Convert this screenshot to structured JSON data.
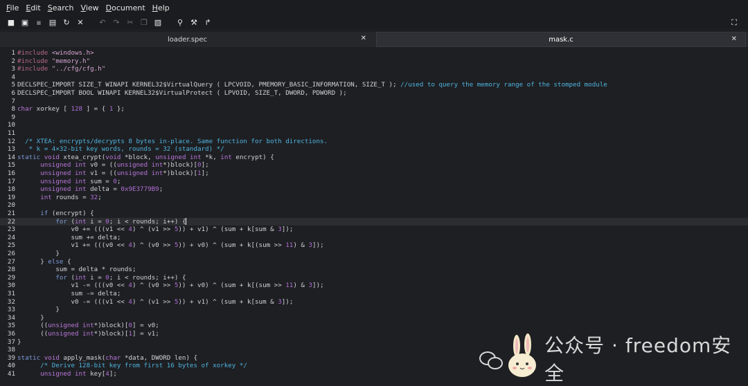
{
  "menu": [
    "File",
    "Edit",
    "Search",
    "View",
    "Document",
    "Help"
  ],
  "menu_underline_first": true,
  "toolbar_icons": [
    {
      "name": "new-file-icon",
      "glyph": "■",
      "dim": false
    },
    {
      "name": "new-window-icon",
      "glyph": "▣",
      "dim": false
    },
    {
      "name": "save-icon",
      "glyph": "▪",
      "dim": true
    },
    {
      "name": "save-as-icon",
      "glyph": "▤",
      "dim": false
    },
    {
      "name": "reload-icon",
      "glyph": "↻",
      "dim": false
    },
    {
      "name": "close-icon",
      "glyph": "✕",
      "dim": false
    },
    {
      "name": "gap",
      "glyph": "",
      "dim": false
    },
    {
      "name": "undo-icon",
      "glyph": "↶",
      "dim": true
    },
    {
      "name": "redo-icon",
      "glyph": "↷",
      "dim": true
    },
    {
      "name": "cut-icon",
      "glyph": "✂",
      "dim": true
    },
    {
      "name": "copy-icon",
      "glyph": "❐",
      "dim": true
    },
    {
      "name": "paste-icon",
      "glyph": "▧",
      "dim": false
    },
    {
      "name": "gap",
      "glyph": "",
      "dim": false
    },
    {
      "name": "search-icon",
      "glyph": "⚲",
      "dim": false
    },
    {
      "name": "replace-icon",
      "glyph": "⚒",
      "dim": false
    },
    {
      "name": "goto-icon",
      "glyph": "↱",
      "dim": false
    }
  ],
  "fullscreen_glyph": "⛶",
  "tabs": [
    {
      "label": "loader.spec",
      "close": "✕"
    },
    {
      "label": "mask.c",
      "close": "✕"
    }
  ],
  "current_line": 22,
  "lines": [
    {
      "n": "1",
      "t": [
        [
          "pp",
          "#include "
        ],
        [
          "str",
          "<windows.h>"
        ]
      ]
    },
    {
      "n": "2",
      "t": [
        [
          "pp",
          "#include "
        ],
        [
          "str",
          "\"memory.h\""
        ]
      ]
    },
    {
      "n": "3",
      "t": [
        [
          "pp",
          "#include "
        ],
        [
          "str",
          "\"../cfg/cfg.h\""
        ]
      ]
    },
    {
      "n": "4",
      "t": []
    },
    {
      "n": "5",
      "t": [
        [
          "",
          "DECLSPEC_IMPORT SIZE_T WINAPI KERNEL32$VirtualQuery ( LPCVOID, PMEMORY_BASIC_INFORMATION, SIZE_T ); "
        ],
        [
          "cm",
          "//used to query the memory range of the stomped module"
        ]
      ]
    },
    {
      "n": "6",
      "t": [
        [
          "",
          "DECLSPEC_IMPORT BOOL WINAPI KERNEL32$VirtualProtect ( LPVOID, SIZE_T, DWORD, PDWORD );"
        ]
      ]
    },
    {
      "n": "7",
      "t": []
    },
    {
      "n": "8",
      "t": [
        [
          "ty",
          "char"
        ],
        [
          "",
          " xorkey [ "
        ],
        [
          "num",
          "128"
        ],
        [
          "",
          " ] = { "
        ],
        [
          "num",
          "1"
        ],
        [
          "",
          " };"
        ]
      ]
    },
    {
      "n": "9",
      "t": []
    },
    {
      "n": "10",
      "t": []
    },
    {
      "n": "11",
      "t": []
    },
    {
      "n": "12",
      "t": [
        [
          "cm",
          "  /* XTEA: encrypts/decrypts 8 bytes in-place. Same function for both directions."
        ]
      ]
    },
    {
      "n": "13",
      "t": [
        [
          "cm",
          "   * k = 4×32-bit key words, rounds = 32 (standard) */"
        ]
      ]
    },
    {
      "n": "14",
      "t": [
        [
          "kw",
          "static"
        ],
        [
          "",
          " "
        ],
        [
          "ty",
          "void"
        ],
        [
          "",
          " xtea_crypt("
        ],
        [
          "ty",
          "void"
        ],
        [
          "",
          " *block, "
        ],
        [
          "ty",
          "unsigned int"
        ],
        [
          "",
          " *k, "
        ],
        [
          "ty",
          "int"
        ],
        [
          "",
          " encrypt) {"
        ]
      ]
    },
    {
      "n": "15",
      "t": [
        [
          "",
          "      "
        ],
        [
          "ty",
          "unsigned int"
        ],
        [
          "",
          " v0 = (("
        ],
        [
          "ty",
          "unsigned int"
        ],
        [
          "",
          "*)block)["
        ],
        [
          "num",
          "0"
        ],
        [
          "",
          "];"
        ]
      ]
    },
    {
      "n": "16",
      "t": [
        [
          "",
          "      "
        ],
        [
          "ty",
          "unsigned int"
        ],
        [
          "",
          " v1 = (("
        ],
        [
          "ty",
          "unsigned int"
        ],
        [
          "",
          "*)block)["
        ],
        [
          "num",
          "1"
        ],
        [
          "",
          "];"
        ]
      ]
    },
    {
      "n": "17",
      "t": [
        [
          "",
          "      "
        ],
        [
          "ty",
          "unsigned int"
        ],
        [
          "",
          " sum = "
        ],
        [
          "num",
          "0"
        ],
        [
          "",
          ";"
        ]
      ]
    },
    {
      "n": "18",
      "t": [
        [
          "",
          "      "
        ],
        [
          "ty",
          "unsigned int"
        ],
        [
          "",
          " delta = "
        ],
        [
          "num",
          "0x9E3779B9"
        ],
        [
          "",
          ";"
        ]
      ]
    },
    {
      "n": "19",
      "t": [
        [
          "",
          "      "
        ],
        [
          "ty",
          "int"
        ],
        [
          "",
          " rounds = "
        ],
        [
          "num",
          "32"
        ],
        [
          "",
          ";"
        ]
      ]
    },
    {
      "n": "20",
      "t": []
    },
    {
      "n": "21",
      "t": [
        [
          "",
          "      "
        ],
        [
          "kw",
          "if"
        ],
        [
          "",
          " (encrypt) {"
        ]
      ]
    },
    {
      "n": "22",
      "t": [
        [
          "",
          "          "
        ],
        [
          "kw",
          "for"
        ],
        [
          "",
          " ("
        ],
        [
          "ty",
          "int"
        ],
        [
          "",
          " i = "
        ],
        [
          "num",
          "0"
        ],
        [
          "",
          "; i < rounds; i++) {"
        ]
      ]
    },
    {
      "n": "23",
      "t": [
        [
          "",
          "              v0 += (((v1 << "
        ],
        [
          "num",
          "4"
        ],
        [
          "",
          ") ^ (v1 >> "
        ],
        [
          "num",
          "5"
        ],
        [
          "",
          ")) + v1) ^ (sum + k[sum & "
        ],
        [
          "num",
          "3"
        ],
        [
          "",
          "]);"
        ]
      ]
    },
    {
      "n": "24",
      "t": [
        [
          "",
          "              sum += delta;"
        ]
      ]
    },
    {
      "n": "25",
      "t": [
        [
          "",
          "              v1 += (((v0 << "
        ],
        [
          "num",
          "4"
        ],
        [
          "",
          ") ^ (v0 >> "
        ],
        [
          "num",
          "5"
        ],
        [
          "",
          ")) + v0) ^ (sum + k[(sum >> "
        ],
        [
          "num",
          "11"
        ],
        [
          "",
          ") & "
        ],
        [
          "num",
          "3"
        ],
        [
          "",
          "]);"
        ]
      ]
    },
    {
      "n": "26",
      "t": [
        [
          "",
          "          }"
        ]
      ]
    },
    {
      "n": "27",
      "t": [
        [
          "",
          "      } "
        ],
        [
          "kw",
          "else"
        ],
        [
          "",
          " {"
        ]
      ]
    },
    {
      "n": "28",
      "t": [
        [
          "",
          "          sum = delta * rounds;"
        ]
      ]
    },
    {
      "n": "29",
      "t": [
        [
          "",
          "          "
        ],
        [
          "kw",
          "for"
        ],
        [
          "",
          " ("
        ],
        [
          "ty",
          "int"
        ],
        [
          "",
          " i = "
        ],
        [
          "num",
          "0"
        ],
        [
          "",
          "; i < rounds; i++) {"
        ]
      ]
    },
    {
      "n": "30",
      "t": [
        [
          "",
          "              v1 -= (((v0 << "
        ],
        [
          "num",
          "4"
        ],
        [
          "",
          ") ^ (v0 >> "
        ],
        [
          "num",
          "5"
        ],
        [
          "",
          ")) + v0) ^ (sum + k[(sum >> "
        ],
        [
          "num",
          "11"
        ],
        [
          "",
          ") & "
        ],
        [
          "num",
          "3"
        ],
        [
          "",
          "]);"
        ]
      ]
    },
    {
      "n": "31",
      "t": [
        [
          "",
          "              sum -= delta;"
        ]
      ]
    },
    {
      "n": "32",
      "t": [
        [
          "",
          "              v0 -= (((v1 << "
        ],
        [
          "num",
          "4"
        ],
        [
          "",
          ") ^ (v1 >> "
        ],
        [
          "num",
          "5"
        ],
        [
          "",
          ")) + v1) ^ (sum + k[sum & "
        ],
        [
          "num",
          "3"
        ],
        [
          "",
          "]);"
        ]
      ]
    },
    {
      "n": "33",
      "t": [
        [
          "",
          "          }"
        ]
      ]
    },
    {
      "n": "34",
      "t": [
        [
          "",
          "      }"
        ]
      ]
    },
    {
      "n": "35",
      "t": [
        [
          "",
          "      (("
        ],
        [
          "ty",
          "unsigned int"
        ],
        [
          "",
          "*)block)["
        ],
        [
          "num",
          "0"
        ],
        [
          "",
          "] = v0;"
        ]
      ]
    },
    {
      "n": "36",
      "t": [
        [
          "",
          "      (("
        ],
        [
          "ty",
          "unsigned int"
        ],
        [
          "",
          "*)block)["
        ],
        [
          "num",
          "1"
        ],
        [
          "",
          "] = v1;"
        ]
      ]
    },
    {
      "n": "37",
      "t": [
        [
          "",
          "}"
        ]
      ]
    },
    {
      "n": "38",
      "t": []
    },
    {
      "n": "39",
      "t": [
        [
          "kw",
          "static"
        ],
        [
          "",
          " "
        ],
        [
          "ty",
          "void"
        ],
        [
          "",
          " apply_mask("
        ],
        [
          "ty",
          "char"
        ],
        [
          "",
          " *data, DWORD len) {"
        ]
      ]
    },
    {
      "n": "40",
      "t": [
        [
          "",
          "      "
        ],
        [
          "cm",
          "/* Derive 128-bit key from first 16 bytes of xorkey */"
        ]
      ]
    },
    {
      "n": "41",
      "t": [
        [
          "",
          "      "
        ],
        [
          "ty",
          "unsigned int"
        ],
        [
          "",
          " key["
        ],
        [
          "num",
          "4"
        ],
        [
          "",
          "];"
        ]
      ]
    }
  ],
  "watermark": {
    "text": "公众号 · freedom安全"
  }
}
